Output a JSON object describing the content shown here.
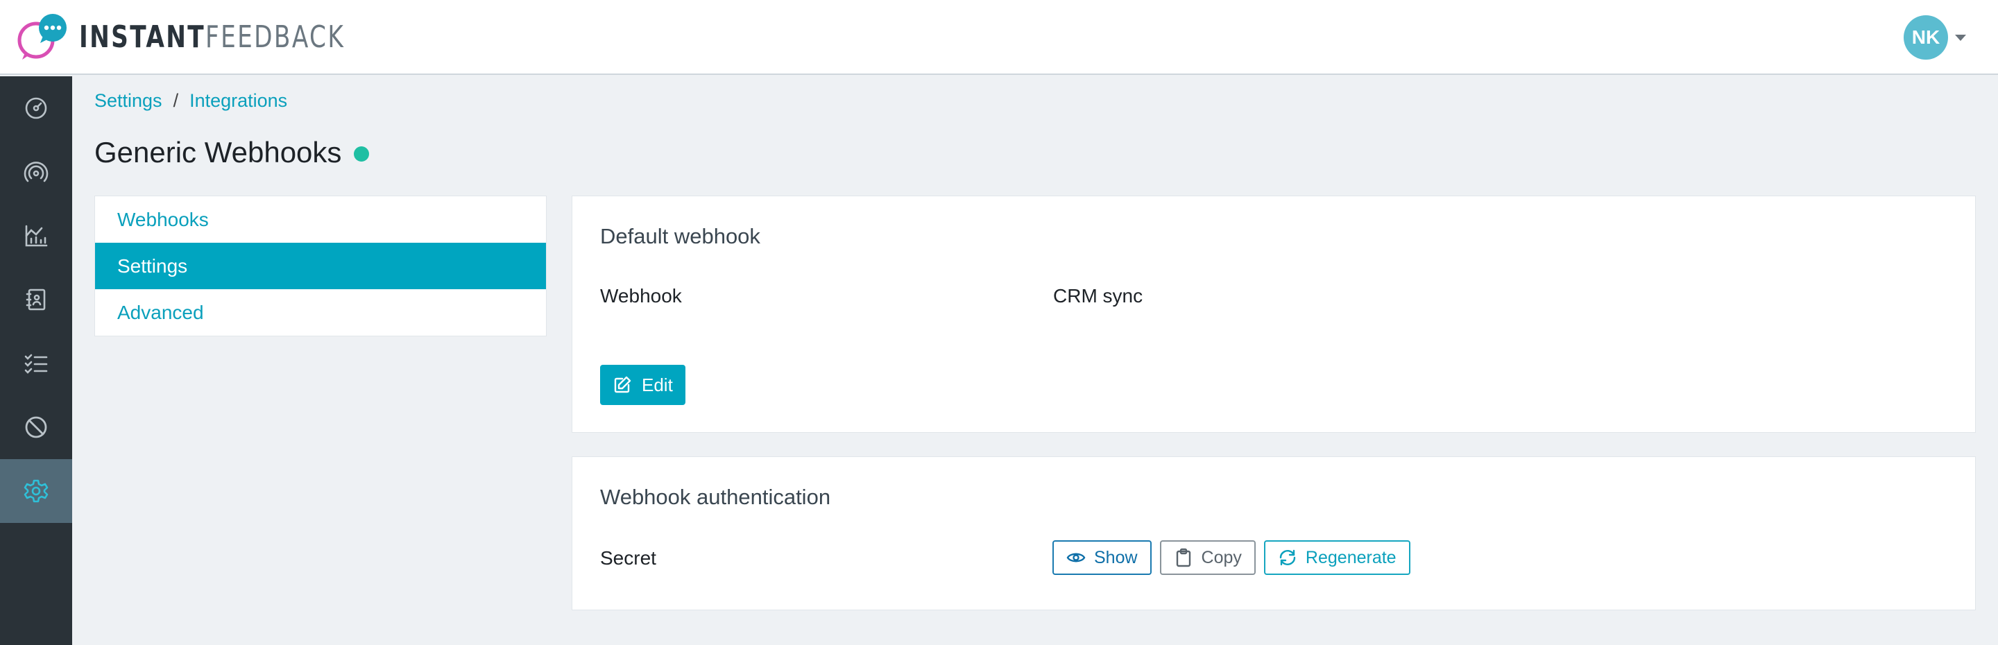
{
  "app": {
    "logo_bold": "INSTANT",
    "logo_light": "FEEDBACK",
    "brand_colors": {
      "bubble_magenta": "#d94fb4",
      "bubble_teal": "#1aa3bf",
      "accent": "#00a5c0"
    }
  },
  "user": {
    "initials": "NK",
    "avatar_color": "#5bbcd0"
  },
  "sidebar": {
    "items": [
      {
        "icon": "dashboard-gauge-icon"
      },
      {
        "icon": "broadcast-icon"
      },
      {
        "icon": "analytics-chart-icon"
      },
      {
        "icon": "contacts-book-icon"
      },
      {
        "icon": "checklist-icon"
      },
      {
        "icon": "block-icon"
      },
      {
        "icon": "gear-icon",
        "active": true
      }
    ]
  },
  "breadcrumb": {
    "items": [
      "Settings",
      "Integrations"
    ],
    "separator": "/"
  },
  "page": {
    "title": "Generic Webhooks",
    "status_color": "#1fbfa3"
  },
  "subnav": {
    "items": [
      {
        "label": "Webhooks"
      },
      {
        "label": "Settings",
        "active": true
      },
      {
        "label": "Advanced"
      }
    ]
  },
  "default_webhook": {
    "title": "Default webhook",
    "label": "Webhook",
    "value": "CRM sync",
    "edit_label": "Edit"
  },
  "auth": {
    "title": "Webhook authentication",
    "label": "Secret",
    "show_label": "Show",
    "copy_label": "Copy",
    "regenerate_label": "Regenerate"
  }
}
